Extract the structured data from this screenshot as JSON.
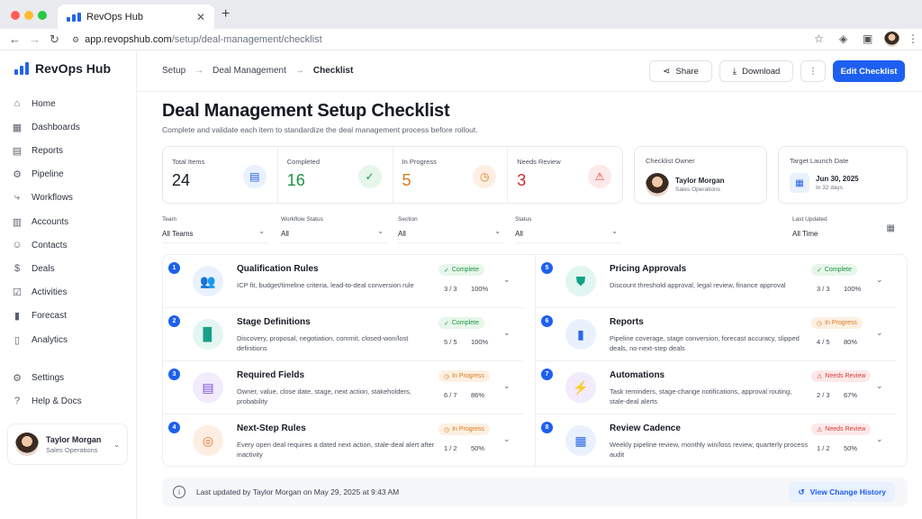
{
  "browser": {
    "tab_title": "RevOps Hub",
    "url_host": "app.revopshub.com",
    "url_path": "/setup/deal-management/checklist"
  },
  "sidebar": {
    "brand": "RevOps Hub",
    "items": [
      {
        "label": "Home",
        "icon": "home-icon"
      },
      {
        "label": "Dashboards",
        "icon": "dashboard-icon"
      },
      {
        "label": "Reports",
        "icon": "report-icon"
      },
      {
        "label": "Pipeline",
        "icon": "pipeline-icon"
      },
      {
        "label": "Workflows",
        "icon": "workflow-icon"
      },
      {
        "label": "Accounts",
        "icon": "accounts-icon"
      },
      {
        "label": "Contacts",
        "icon": "contacts-icon"
      },
      {
        "label": "Deals",
        "icon": "deals-icon"
      },
      {
        "label": "Activities",
        "icon": "activities-icon"
      },
      {
        "label": "Forecast",
        "icon": "forecast-icon"
      },
      {
        "label": "Analytics",
        "icon": "analytics-icon"
      }
    ],
    "bottom_items": [
      {
        "label": "Settings",
        "icon": "gear-icon"
      },
      {
        "label": "Help & Docs",
        "icon": "help-icon"
      }
    ],
    "user": {
      "name": "Taylor Morgan",
      "role": "Sales Operations"
    }
  },
  "header": {
    "breadcrumb": [
      "Setup",
      "Deal Management",
      "Checklist"
    ],
    "share_label": "Share",
    "download_label": "Download",
    "edit_label": "Edit Checklist"
  },
  "page": {
    "title": "Deal Management Setup Checklist",
    "subtitle": "Complete and validate each item to standardize the deal management process before rollout."
  },
  "stats": [
    {
      "label": "Total Items",
      "value": "24",
      "color": "#161a24",
      "icon": "clipboard-icon"
    },
    {
      "label": "Completed",
      "value": "16",
      "color": "#1e9244",
      "icon": "check-icon"
    },
    {
      "label": "In Progress",
      "value": "5",
      "color": "#d9791c",
      "icon": "clock-icon"
    },
    {
      "label": "Needs Review",
      "value": "3",
      "color": "#c62f2f",
      "icon": "warning-icon"
    }
  ],
  "owner": {
    "label": "Checklist Owner",
    "name": "Taylor Morgan",
    "role": "Sales Operations"
  },
  "launch": {
    "label": "Target Launch Date",
    "date": "Jun 30, 2025",
    "remaining": "In 32 days"
  },
  "filters": [
    {
      "label": "Team",
      "value": "All Teams"
    },
    {
      "label": "Workflow Status",
      "value": "All"
    },
    {
      "label": "Section",
      "value": "All"
    },
    {
      "label": "Status",
      "value": "All"
    },
    {
      "label": "Last Updated",
      "value": "All Time"
    }
  ],
  "checklist": [
    {
      "num": "1",
      "title": "Qualification Rules",
      "desc": "ICP fit, budget/timeline criteria, lead-to-deal conversion rule",
      "status": "Complete",
      "fraction": "3 / 3",
      "percent": "100%",
      "icon": "users-icon",
      "accent": "#2f66e8",
      "bg": "#eaf1fe"
    },
    {
      "num": "2",
      "title": "Stage Definitions",
      "desc": "Discovery, proposal, negotiation, commit, closed-won/lost definitions",
      "status": "Complete",
      "fraction": "5 / 5",
      "percent": "100%",
      "icon": "document-icon",
      "accent": "#1a9f8a",
      "bg": "#e4f6f2"
    },
    {
      "num": "3",
      "title": "Required Fields",
      "desc": "Owner, value, close date, stage, next action, stakeholders, probability",
      "status": "In Progress",
      "fraction": "6 / 7",
      "percent": "86%",
      "icon": "clipboard-list-icon",
      "accent": "#7a4fd6",
      "bg": "#f1ebfc"
    },
    {
      "num": "4",
      "title": "Next-Step Rules",
      "desc": "Every open deal requires a dated next action, stale-deal alert after inactivity",
      "status": "In Progress",
      "fraction": "1 / 2",
      "percent": "50%",
      "icon": "target-icon",
      "accent": "#e2732a",
      "bg": "#fdeee2"
    },
    {
      "num": "5",
      "title": "Pricing Approvals",
      "desc": "Discount threshold approval, legal review, finance approval",
      "status": "Complete",
      "fraction": "3 / 3",
      "percent": "100%",
      "icon": "shield-check-icon",
      "accent": "#14a28a",
      "bg": "#e2f6f1"
    },
    {
      "num": "6",
      "title": "Reports",
      "desc": "Pipeline coverage, stage conversion, forecast accuracy, slipped deals, no-next-step deals",
      "status": "In Progress",
      "fraction": "4 / 5",
      "percent": "80%",
      "icon": "bar-chart-icon",
      "accent": "#2f66e8",
      "bg": "#eaf1fe"
    },
    {
      "num": "7",
      "title": "Automations",
      "desc": "Task reminders, stage-change notifications, approval routing, stale-deal alerts",
      "status": "Needs Review",
      "fraction": "2 / 3",
      "percent": "67%",
      "icon": "lightning-icon",
      "accent": "#7a4fd6",
      "bg": "#f1ebfc"
    },
    {
      "num": "8",
      "title": "Review Cadence",
      "desc": "Weekly pipeline review, monthly win/loss review, quarterly process audit",
      "status": "Needs Review",
      "fraction": "1 / 2",
      "percent": "50%",
      "icon": "calendar-icon",
      "accent": "#2f66e8",
      "bg": "#eaf1fe"
    }
  ],
  "footer": {
    "updated_text": "Last updated by Taylor Morgan on May 29, 2025 at 9:43 AM",
    "history_label": "View Change History"
  }
}
